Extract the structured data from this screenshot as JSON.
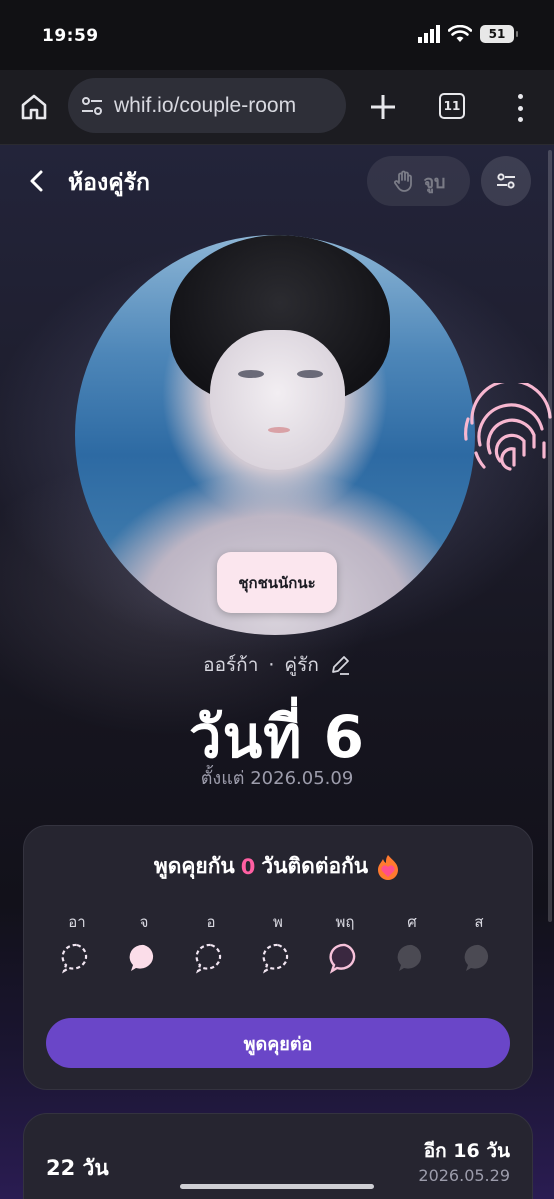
{
  "status_bar": {
    "time": "19:59",
    "battery": "51"
  },
  "browser": {
    "url": "whif.io/couple-room",
    "tab_count": "11"
  },
  "page": {
    "title": "ห้องคู่รัก",
    "kiss_label": "จูบ"
  },
  "hero": {
    "speech_bubble": "ชุกชนนักนะ",
    "partner_name": "ออร์ก้า",
    "separator": "·",
    "relation": "คู่รัก",
    "day_label": "วันที่ 6",
    "since": "ตั้งแต่ 2026.05.09"
  },
  "streak": {
    "prefix": "พูดคุยกัน",
    "count": "0",
    "suffix": "วันติดต่อกัน",
    "days": [
      {
        "label": "อา",
        "state": "missed"
      },
      {
        "label": "จ",
        "state": "chatted"
      },
      {
        "label": "อ",
        "state": "missed"
      },
      {
        "label": "พ",
        "state": "missed"
      },
      {
        "label": "พฤ",
        "state": "today"
      },
      {
        "label": "ศ",
        "state": "future"
      },
      {
        "label": "ส",
        "state": "future"
      }
    ],
    "button": "พูดคุยต่อ"
  },
  "anniversary": {
    "days": "22 วัน",
    "remaining": "อีก 16 วัน",
    "date": "2026.05.29"
  },
  "colors": {
    "accent": "#6a46c8",
    "streak_count": "#ff5fa2",
    "card_bg": "#262530",
    "bubble_bg": "#fbe6ee"
  }
}
